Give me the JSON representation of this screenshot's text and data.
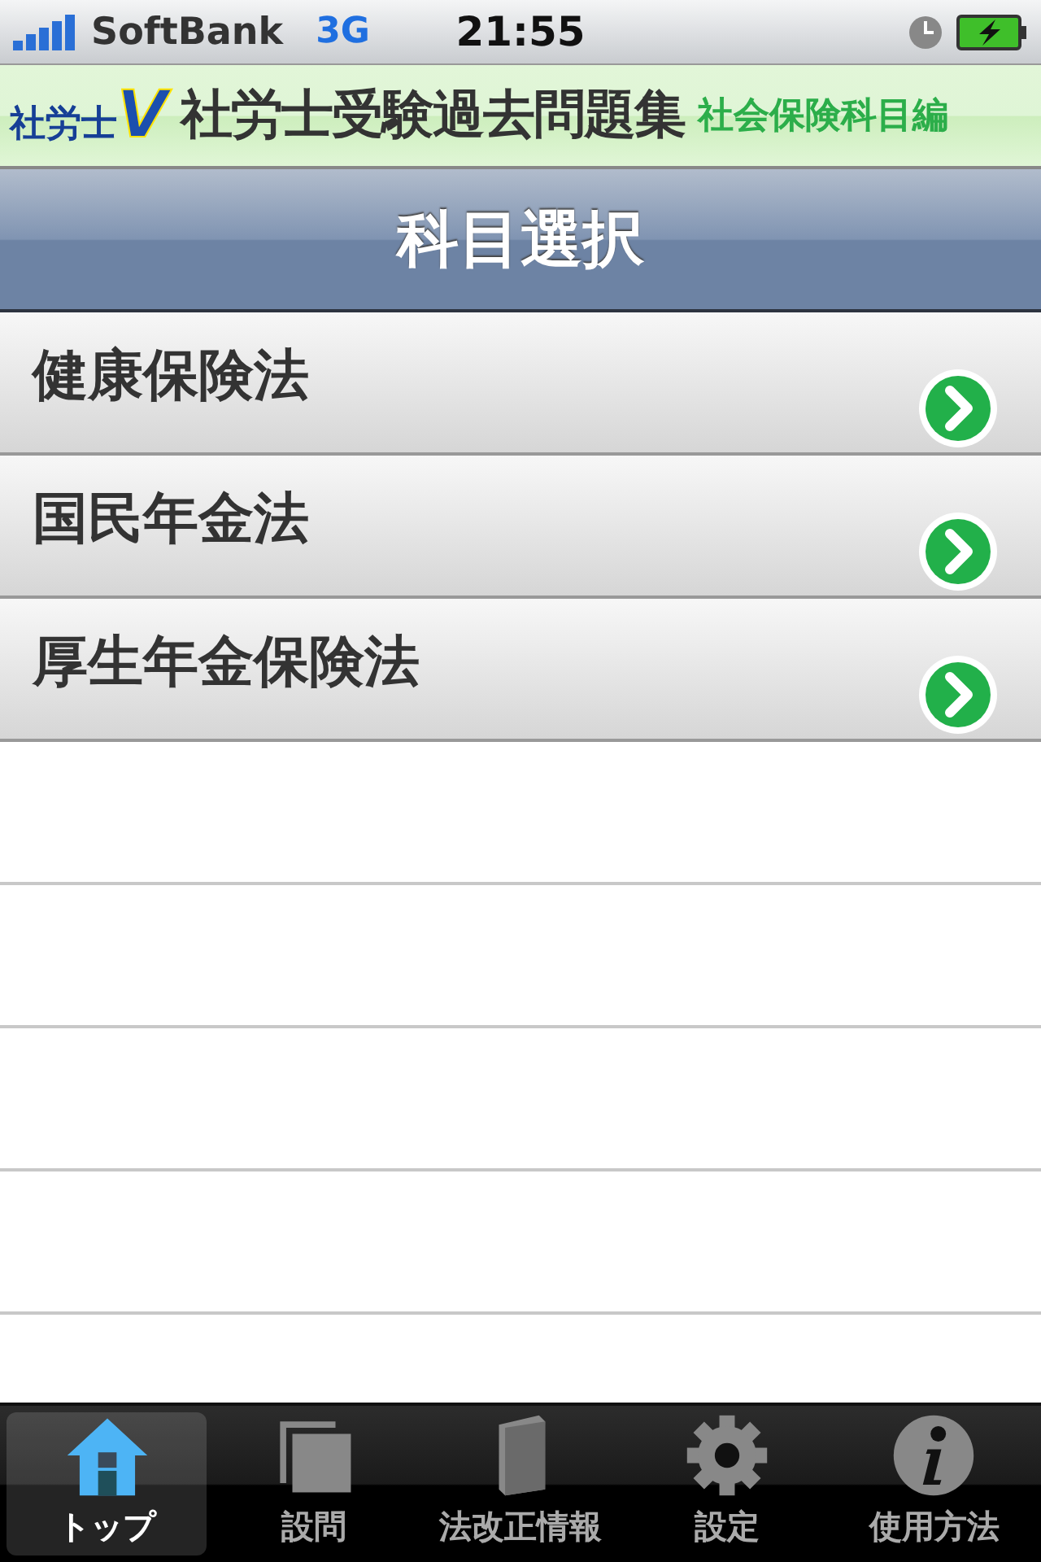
{
  "status_bar": {
    "carrier": "SoftBank",
    "network": "3G",
    "time": "21:55"
  },
  "banner": {
    "logo_text": "社労士",
    "logo_mark": "V",
    "title": "社労士受験過去問題集",
    "subtitle": "社会保険科目編"
  },
  "nav_bar": {
    "title": "科目選択"
  },
  "subjects": [
    {
      "label": "健康保険法"
    },
    {
      "label": "国民年金法"
    },
    {
      "label": "厚生年金保険法"
    }
  ],
  "tab_bar": [
    {
      "label": "トップ",
      "kind": "home",
      "selected": true
    },
    {
      "label": "設問",
      "kind": "pages",
      "selected": false
    },
    {
      "label": "法改正情報",
      "kind": "book",
      "selected": false
    },
    {
      "label": "設定",
      "kind": "gear",
      "selected": false
    },
    {
      "label": "使用方法",
      "kind": "info",
      "selected": false
    }
  ]
}
